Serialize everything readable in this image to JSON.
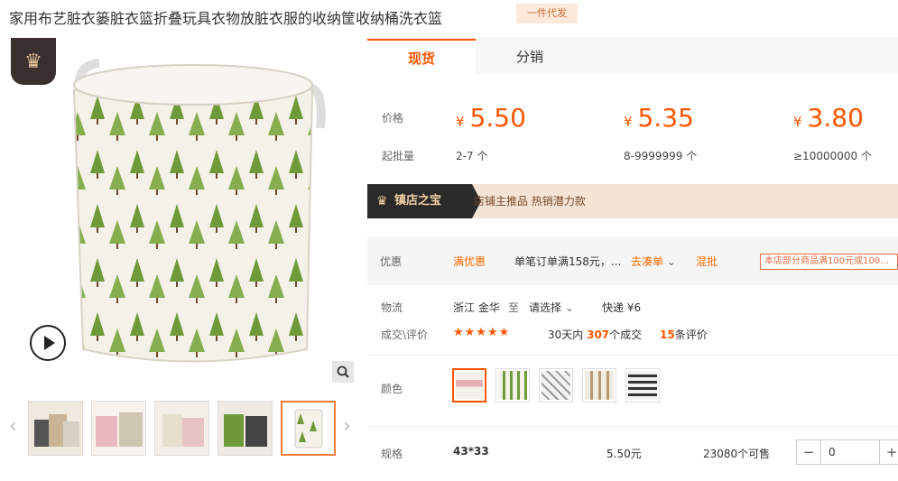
{
  "product": {
    "title": "家用布艺脏衣篓脏衣篮折叠玩具衣物放脏衣服的收纳筐收纳桶洗衣篮",
    "badge": "一件代发"
  },
  "tabs": [
    {
      "label": "现货"
    },
    {
      "label": "分销"
    }
  ],
  "pricing": {
    "price_label": "价格",
    "moq_label": "起批量",
    "currency_symbol": "¥",
    "tiers": [
      {
        "price": "5.50",
        "qty": "2-7 个"
      },
      {
        "price": "5.35",
        "qty": "8-9999999 个"
      },
      {
        "price": "3.80",
        "qty": "≥10000000 个"
      }
    ]
  },
  "treasure": {
    "tag": "镇店之宝",
    "text": "店铺主推品   热销潜力款"
  },
  "promo": {
    "label": "优惠",
    "coupon": "满优惠",
    "desc": "单笔订单满158元，...",
    "collect": "去凑单",
    "mixed": "混批",
    "notice": "本店部分商品满100元或100..."
  },
  "logistics": {
    "label": "物流",
    "from": "浙江  金华",
    "to_word": "至",
    "select": "请选择",
    "express": "快递",
    "fee": "¥6"
  },
  "reviews": {
    "label": "成交\\评价",
    "stars": "★★★★★",
    "days_prefix": "30天内",
    "deals": "307",
    "deals_suffix": "个成交",
    "count": "15",
    "count_suffix": "条评价"
  },
  "color": {
    "label": "颜色"
  },
  "spec": {
    "label": "规格",
    "size": "43*33",
    "price": "5.50元",
    "stock": "23080个可售",
    "quantity": "0",
    "minus": "−",
    "plus": "+"
  },
  "colors": {
    "accent": "#ff5500",
    "tree_green": "#6e9a3a"
  }
}
